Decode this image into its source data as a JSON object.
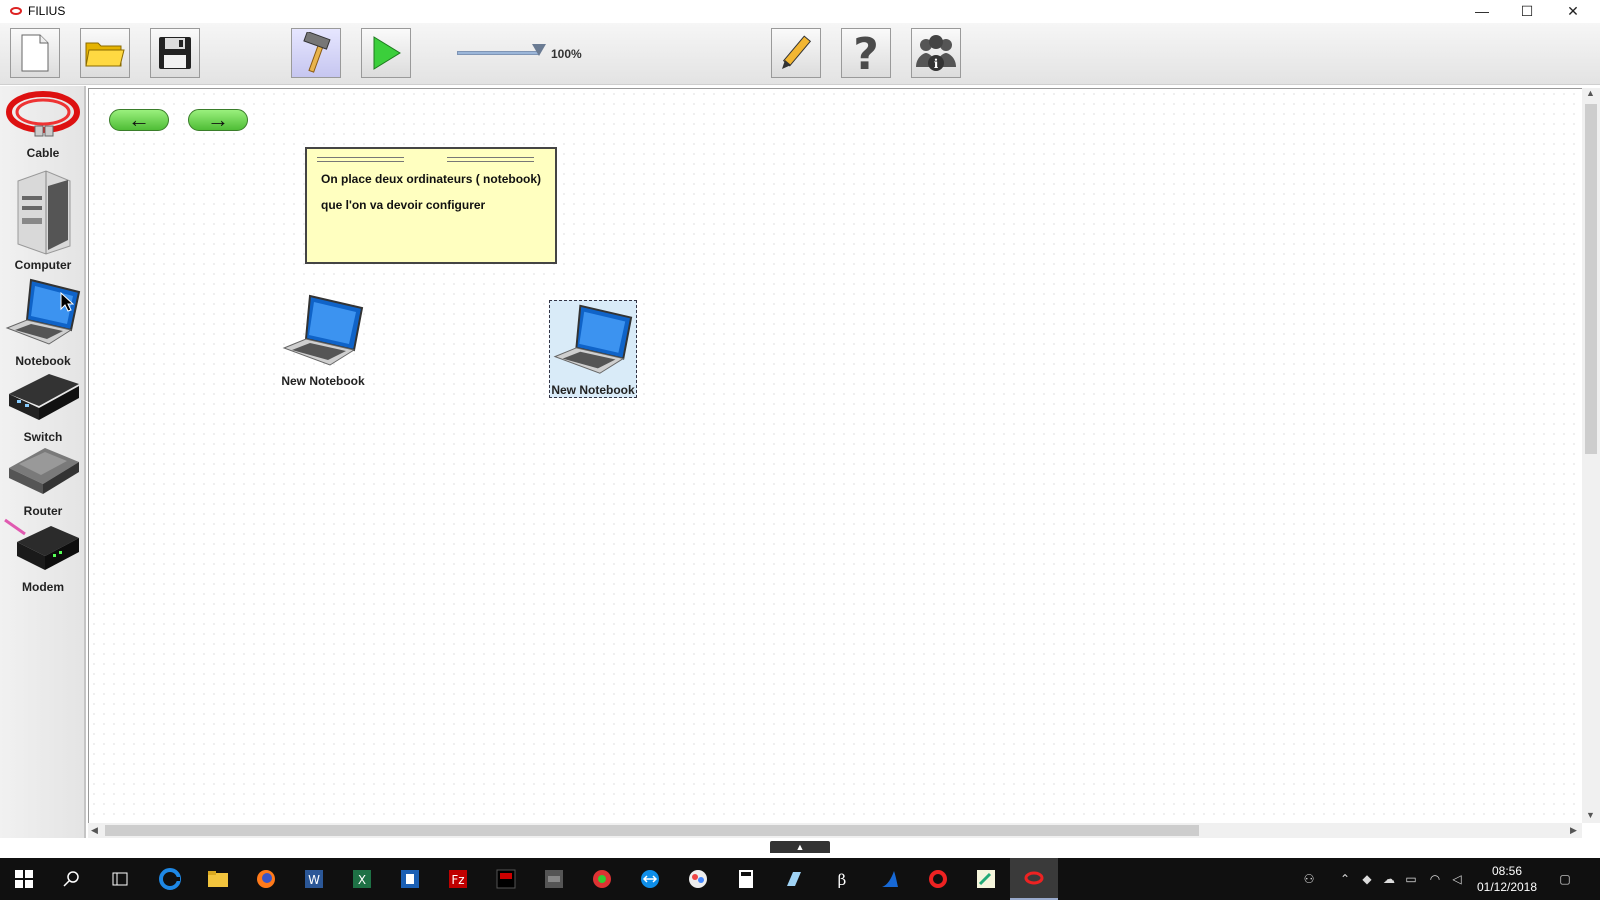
{
  "window": {
    "title": "FILIUS",
    "controls": [
      "—",
      "☐",
      "✕"
    ]
  },
  "toolbar": {
    "zoom_label": "100%",
    "zoom_level_percent": 100,
    "buttons": [
      "new-file",
      "open-folder",
      "save",
      "design-mode",
      "simulation-mode",
      "edit-pencil",
      "help",
      "info"
    ]
  },
  "palette": {
    "items": [
      {
        "label": "Cable"
      },
      {
        "label": "Computer"
      },
      {
        "label": "Notebook"
      },
      {
        "label": "Switch"
      },
      {
        "label": "Router"
      },
      {
        "label": "Modem"
      }
    ]
  },
  "navigation": {
    "back": "←",
    "forward": "→"
  },
  "note": {
    "line1": "On place deux ordinateurs ( notebook)",
    "line2": "que l'on va devoir configurer"
  },
  "devices": [
    {
      "label": "New Notebook",
      "selected": false
    },
    {
      "label": "New Notebook",
      "selected": true
    }
  ],
  "taskbar": {
    "apps": [
      "windows-start",
      "search",
      "task-view",
      "edge",
      "file-explorer",
      "firefox",
      "word",
      "excel",
      "app-blue",
      "filezilla",
      "app-black",
      "app-gray",
      "app-red-green",
      "teamviewer",
      "app-colorful",
      "calculator",
      "app-light-blue",
      "app-b3",
      "app-shark",
      "app-red-ring",
      "app-paint",
      "filius"
    ],
    "clock": {
      "time": "08:56",
      "date": "01/12/2018"
    }
  },
  "colors": {
    "accent": "#4fbd36",
    "note_bg": "#ffffc0",
    "selection": "#d9ebf8",
    "cable_red": "#d22"
  }
}
